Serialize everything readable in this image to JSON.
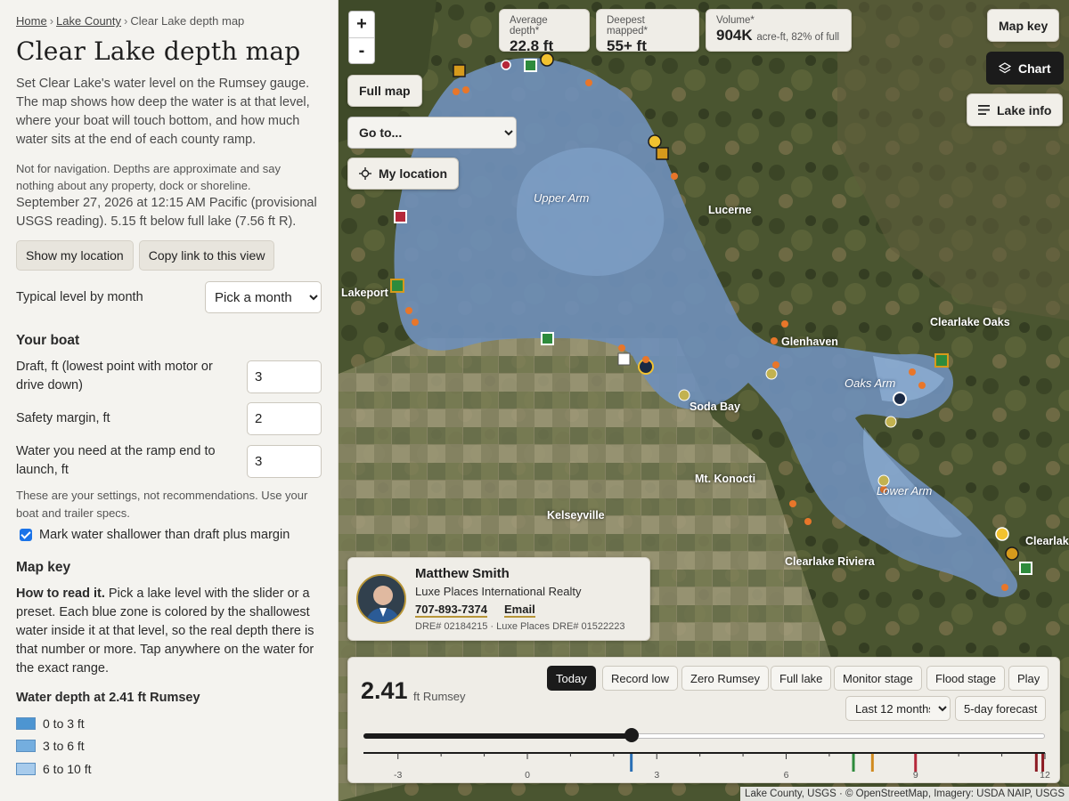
{
  "breadcrumb": {
    "home": "Home",
    "county": "Lake County",
    "current": "Clear Lake depth map",
    "sep": "›"
  },
  "page_title": "Clear Lake depth map",
  "intro": "Set Clear Lake's water level on the Rumsey gauge. The map shows how deep the water is at that level, where your boat will touch bottom, and how much water sits at the end of each county ramp.",
  "disclaimer": "Not for navigation. Depths are approximate and say nothing about any property, dock or shoreline.",
  "reading": "September 27, 2026 at 12:15 AM Pacific (provisional USGS reading). 5.15 ft below full lake (7.56 ft R).",
  "buttons": {
    "show_location": "Show my location",
    "copy_link": "Copy link to this view"
  },
  "month": {
    "label": "Typical level by month",
    "selected": "Pick a month"
  },
  "boat": {
    "heading": "Your boat",
    "draft_label": "Draft, ft (lowest point with motor or drive down)",
    "draft_value": "3",
    "margin_label": "Safety margin, ft",
    "margin_value": "2",
    "ramp_label": "Water you need at the ramp end to launch, ft",
    "ramp_value": "3",
    "note": "These are your settings, not recommendations. Use your boat and trailer specs.",
    "checkbox_label": "Mark water shallower than draft plus margin",
    "checkbox_checked": true
  },
  "map_key": {
    "heading": "Map key",
    "howto_bold": "How to read it.",
    "howto_text": " Pick a lake level with the slider or a preset. Each blue zone is colored by the shallowest water inside it at that level, so the real depth there is that number or more. Tap anywhere on the water for the exact range.",
    "legend_title": "Water depth at 2.41 ft Rumsey",
    "legend": [
      {
        "label": "0 to 3 ft",
        "color": "#4d95d1"
      },
      {
        "label": "3 to 6 ft",
        "color": "#74aedf"
      },
      {
        "label": "6 to 10 ft",
        "color": "#a7cbec"
      }
    ]
  },
  "map": {
    "zoom_in": "+",
    "zoom_out": "-",
    "full_map": "Full map",
    "goto_placeholder": "Go to...",
    "my_location": "My location",
    "stats": [
      {
        "key": "Average depth*",
        "value": "22.8 ft",
        "extra": ""
      },
      {
        "key": "Deepest mapped*",
        "value": "55+ ft",
        "extra": ""
      },
      {
        "key": "Volume*",
        "value": "904K",
        "extra": "acre-ft, 82% of full"
      }
    ],
    "map_key_btn": "Map key",
    "chart_btn": "Chart",
    "lake_info_btn": "Lake info",
    "places": [
      {
        "id": "lakeport",
        "label": "Lakeport"
      },
      {
        "id": "lucerne",
        "label": "Lucerne"
      },
      {
        "id": "clearlake-oaks",
        "label": "Clearlake Oaks"
      },
      {
        "id": "glenhaven",
        "label": "Glenhaven"
      },
      {
        "id": "soda-bay",
        "label": "Soda Bay"
      },
      {
        "id": "mt-konocti",
        "label": "Mt. Konocti"
      },
      {
        "id": "kelseyville",
        "label": "Kelseyville"
      },
      {
        "id": "clearlake-riviera",
        "label": "Clearlake Riviera"
      },
      {
        "id": "clearlake",
        "label": "Clearlak"
      }
    ],
    "water": [
      {
        "id": "upper-arm",
        "label": "Upper Arm"
      },
      {
        "id": "oaks-arm",
        "label": "Oaks Arm"
      },
      {
        "id": "lower-arm",
        "label": "Lower Arm"
      }
    ],
    "attribution": "Lake County, USGS · © OpenStreetMap, Imagery: USDA NAIP, USGS"
  },
  "agent": {
    "name": "Matthew Smith",
    "firm": "Luxe Places International Realty",
    "phone": "707-893-7374",
    "email": "Email",
    "dre": "DRE# 02184215 · Luxe Places DRE# 01522223"
  },
  "timeline": {
    "level": "2.41",
    "unit": "ft Rumsey",
    "level_value": 2.41,
    "axis_min": -3.8,
    "axis_max": 12,
    "presets": [
      "Today",
      "Record low",
      "Zero Rumsey",
      "Full lake",
      "Monitor stage",
      "Flood stage",
      "Play"
    ],
    "active_preset": "Today",
    "range": "Last 12 months",
    "forecast": "5-day forecast",
    "ticks": [
      "-3",
      "0",
      "3",
      "6",
      "9",
      "12"
    ],
    "markers": [
      {
        "value": 2.41,
        "color": "#2a6fb5"
      },
      {
        "value": 7.56,
        "color": "#2e8b3c"
      },
      {
        "value": 8.0,
        "color": "#d08a1e"
      },
      {
        "value": 9.0,
        "color": "#b5283a"
      },
      {
        "value": 11.8,
        "color": "#8c1a22"
      },
      {
        "value": 11.95,
        "color": "#8c1a22"
      }
    ]
  }
}
